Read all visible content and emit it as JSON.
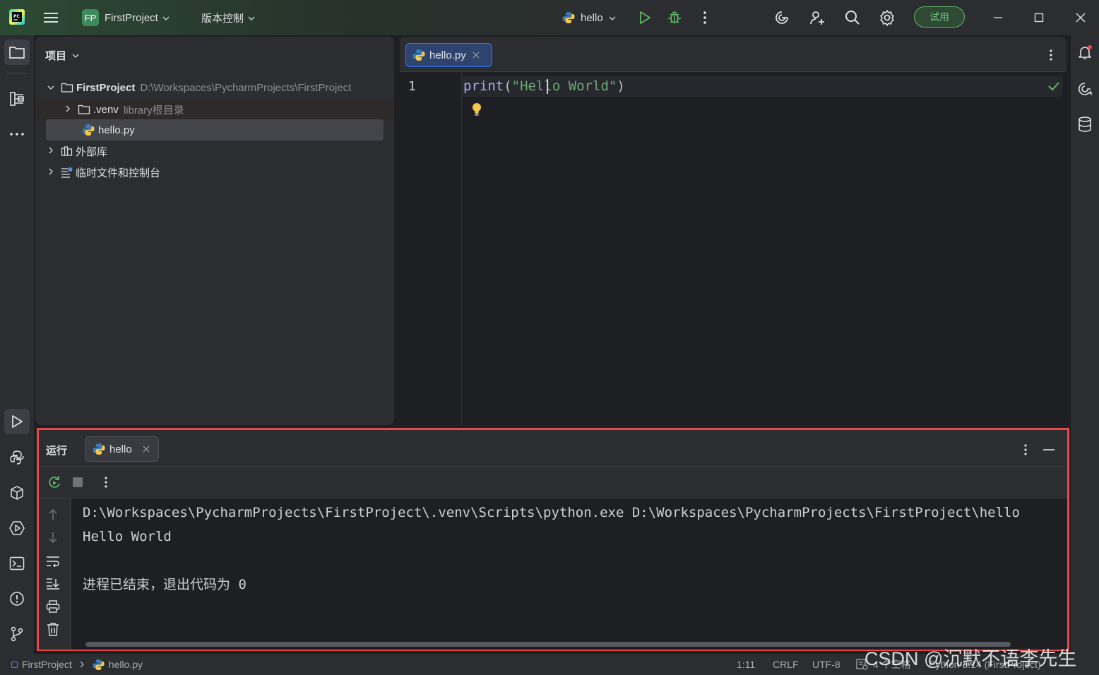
{
  "titlebar": {
    "project_badge": "FP",
    "project_name": "FirstProject",
    "vcs_menu": "版本控制",
    "run_config": "hello",
    "trial_button": "试用"
  },
  "project_panel": {
    "title": "项目",
    "tree": [
      {
        "name": "FirstProject",
        "hint": "D:\\Workspaces\\PycharmProjects\\FirstProject"
      },
      {
        "name": ".venv",
        "hint": "library根目录"
      },
      {
        "name": "hello.py",
        "hint": ""
      },
      {
        "name": "外部库",
        "hint": ""
      },
      {
        "name": "临时文件和控制台",
        "hint": ""
      }
    ]
  },
  "editor": {
    "tab_label": "hello.py",
    "line_number": "1",
    "code": {
      "func": "print",
      "open": "(",
      "string": "\"Hello World\"",
      "close": ")"
    }
  },
  "run_panel": {
    "title": "运行",
    "tab_label": "hello",
    "output": [
      "D:\\Workspaces\\PycharmProjects\\FirstProject\\.venv\\Scripts\\python.exe D:\\Workspaces\\PycharmProjects\\FirstProject\\hello",
      "Hello World",
      "",
      "进程已结束，退出代码为 0"
    ]
  },
  "statusbar": {
    "breadcrumb_project": "FirstProject",
    "breadcrumb_file": "hello.py",
    "position": "1:11",
    "line_sep": "CRLF",
    "encoding": "UTF-8",
    "indent": "4 个空格",
    "interpreter": "Python 3.14 (FirstProject)"
  },
  "watermark": "CSDN @沉默不语李先生",
  "colors": {
    "accent_green": "#5fb865",
    "highlight_red": "#e5484d",
    "string_green": "#6aab73",
    "keyword_purple": "#b3a8f0"
  }
}
